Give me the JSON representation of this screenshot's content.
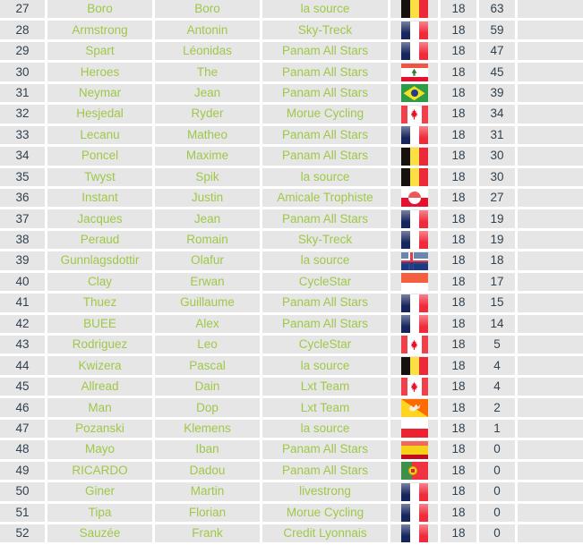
{
  "table": {
    "columns": [
      "rank",
      "last_name",
      "first_name",
      "team",
      "flag",
      "races",
      "points",
      "extra"
    ],
    "rows": [
      {
        "rank": "27",
        "last_name": "Boro",
        "first_name": "Boro",
        "team": "la source",
        "flag": "be",
        "races": "18",
        "points": "63",
        "extra": ""
      },
      {
        "rank": "28",
        "last_name": "Armstrong",
        "first_name": "Antonin",
        "team": "Sky-Treck",
        "flag": "fr",
        "races": "18",
        "points": "59",
        "extra": ""
      },
      {
        "rank": "29",
        "last_name": "Spart",
        "first_name": "Léonidas",
        "team": "Panam All Stars",
        "flag": "fr",
        "races": "18",
        "points": "47",
        "extra": ""
      },
      {
        "rank": "30",
        "last_name": "Heroes",
        "first_name": "The",
        "team": "Panam All Stars",
        "flag": "lb",
        "races": "18",
        "points": "45",
        "extra": ""
      },
      {
        "rank": "31",
        "last_name": "Neymar",
        "first_name": "Jean",
        "team": "Panam All Stars",
        "flag": "br",
        "races": "18",
        "points": "39",
        "extra": ""
      },
      {
        "rank": "32",
        "last_name": "Hesjedal",
        "first_name": "Ryder",
        "team": "Morue Cycling",
        "flag": "ca",
        "races": "18",
        "points": "34",
        "extra": ""
      },
      {
        "rank": "33",
        "last_name": "Lecanu",
        "first_name": "Matheo",
        "team": "Panam All Stars",
        "flag": "fr",
        "races": "18",
        "points": "31",
        "extra": ""
      },
      {
        "rank": "34",
        "last_name": "Poncel",
        "first_name": "Maxime",
        "team": "Panam All Stars",
        "flag": "be",
        "races": "18",
        "points": "30",
        "extra": ""
      },
      {
        "rank": "35",
        "last_name": "Twyst",
        "first_name": "Spik",
        "team": "la source",
        "flag": "be",
        "races": "18",
        "points": "30",
        "extra": ""
      },
      {
        "rank": "36",
        "last_name": "Instant",
        "first_name": "Justin",
        "team": "Amicale Trophiste",
        "flag": "gl",
        "races": "18",
        "points": "27",
        "extra": ""
      },
      {
        "rank": "37",
        "last_name": "Jacques",
        "first_name": "Jean",
        "team": "Panam All Stars",
        "flag": "fr",
        "races": "18",
        "points": "19",
        "extra": ""
      },
      {
        "rank": "38",
        "last_name": "Peraud",
        "first_name": "Romain",
        "team": "Sky-Treck",
        "flag": "fr",
        "races": "18",
        "points": "19",
        "extra": ""
      },
      {
        "rank": "39",
        "last_name": "Gunnlagsdottir",
        "first_name": "Olafur",
        "team": "la source",
        "flag": "is",
        "races": "18",
        "points": "18",
        "extra": ""
      },
      {
        "rank": "40",
        "last_name": "Clay",
        "first_name": "Erwan",
        "team": "CycleStar",
        "flag": "mc",
        "races": "18",
        "points": "17",
        "extra": ""
      },
      {
        "rank": "41",
        "last_name": "Thuez",
        "first_name": "Guillaume",
        "team": "Panam All Stars",
        "flag": "fr",
        "races": "18",
        "points": "15",
        "extra": ""
      },
      {
        "rank": "42",
        "last_name": "BUEE",
        "first_name": "Alex",
        "team": "Panam All Stars",
        "flag": "fr",
        "races": "18",
        "points": "14",
        "extra": ""
      },
      {
        "rank": "43",
        "last_name": "Rodriguez",
        "first_name": "Leo",
        "team": "CycleStar",
        "flag": "ca",
        "races": "18",
        "points": "5",
        "extra": ""
      },
      {
        "rank": "44",
        "last_name": "Kwizera",
        "first_name": "Pascal",
        "team": "la source",
        "flag": "be",
        "races": "18",
        "points": "4",
        "extra": ""
      },
      {
        "rank": "45",
        "last_name": "Allread",
        "first_name": "Dain",
        "team": "Lxt Team",
        "flag": "ca",
        "races": "18",
        "points": "4",
        "extra": ""
      },
      {
        "rank": "46",
        "last_name": "Man",
        "first_name": "Dop",
        "team": "Lxt Team",
        "flag": "bt",
        "races": "18",
        "points": "2",
        "extra": ""
      },
      {
        "rank": "47",
        "last_name": "Pozanski",
        "first_name": "Klemens",
        "team": "la source",
        "flag": "pl",
        "races": "18",
        "points": "1",
        "extra": ""
      },
      {
        "rank": "48",
        "last_name": "Mayo",
        "first_name": "Iban",
        "team": "Panam All Stars",
        "flag": "es",
        "races": "18",
        "points": "0",
        "extra": ""
      },
      {
        "rank": "49",
        "last_name": "RICARDO",
        "first_name": "Dadou",
        "team": "Panam All Stars",
        "flag": "pt",
        "races": "18",
        "points": "0",
        "extra": ""
      },
      {
        "rank": "50",
        "last_name": "Giner",
        "first_name": "Martin",
        "team": "livestrong",
        "flag": "fr",
        "races": "18",
        "points": "0",
        "extra": ""
      },
      {
        "rank": "51",
        "last_name": "Tipa",
        "first_name": "Florian",
        "team": "Morue Cycling",
        "flag": "fr",
        "races": "18",
        "points": "0",
        "extra": ""
      },
      {
        "rank": "52",
        "last_name": "Sauzée",
        "first_name": "Frank",
        "team": "Credit Lyonnais",
        "flag": "fr",
        "races": "18",
        "points": "0",
        "extra": ""
      }
    ]
  },
  "flag_names": {
    "be": "belgium-flag-icon",
    "fr": "france-flag-icon",
    "lb": "lebanon-flag-icon",
    "br": "brazil-flag-icon",
    "ca": "canada-flag-icon",
    "gl": "greenland-flag-icon",
    "is": "iceland-flag-icon",
    "mc": "monaco-flag-icon",
    "bt": "bhutan-flag-icon",
    "pl": "poland-flag-icon",
    "es": "spain-flag-icon",
    "pt": "portugal-flag-icon"
  },
  "colors": {
    "cell_background": "#e6e6e6",
    "page_background": "#ffffff",
    "name_text": "#9fc848",
    "number_text": "#31414f"
  }
}
